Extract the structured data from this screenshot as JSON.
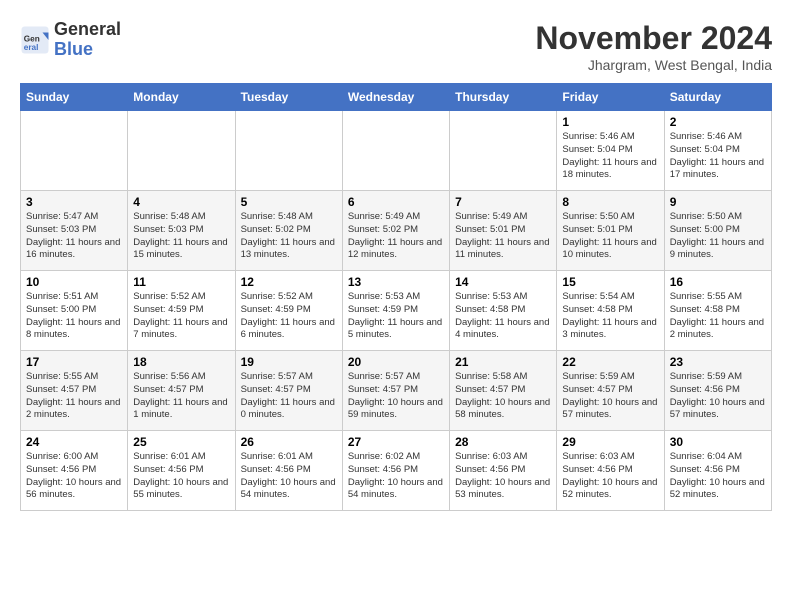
{
  "header": {
    "logo_general": "General",
    "logo_blue": "Blue",
    "month_title": "November 2024",
    "location": "Jhargram, West Bengal, India"
  },
  "days_of_week": [
    "Sunday",
    "Monday",
    "Tuesday",
    "Wednesday",
    "Thursday",
    "Friday",
    "Saturday"
  ],
  "weeks": [
    [
      {
        "day": "",
        "info": ""
      },
      {
        "day": "",
        "info": ""
      },
      {
        "day": "",
        "info": ""
      },
      {
        "day": "",
        "info": ""
      },
      {
        "day": "",
        "info": ""
      },
      {
        "day": "1",
        "info": "Sunrise: 5:46 AM\nSunset: 5:04 PM\nDaylight: 11 hours and 18 minutes."
      },
      {
        "day": "2",
        "info": "Sunrise: 5:46 AM\nSunset: 5:04 PM\nDaylight: 11 hours and 17 minutes."
      }
    ],
    [
      {
        "day": "3",
        "info": "Sunrise: 5:47 AM\nSunset: 5:03 PM\nDaylight: 11 hours and 16 minutes."
      },
      {
        "day": "4",
        "info": "Sunrise: 5:48 AM\nSunset: 5:03 PM\nDaylight: 11 hours and 15 minutes."
      },
      {
        "day": "5",
        "info": "Sunrise: 5:48 AM\nSunset: 5:02 PM\nDaylight: 11 hours and 13 minutes."
      },
      {
        "day": "6",
        "info": "Sunrise: 5:49 AM\nSunset: 5:02 PM\nDaylight: 11 hours and 12 minutes."
      },
      {
        "day": "7",
        "info": "Sunrise: 5:49 AM\nSunset: 5:01 PM\nDaylight: 11 hours and 11 minutes."
      },
      {
        "day": "8",
        "info": "Sunrise: 5:50 AM\nSunset: 5:01 PM\nDaylight: 11 hours and 10 minutes."
      },
      {
        "day": "9",
        "info": "Sunrise: 5:50 AM\nSunset: 5:00 PM\nDaylight: 11 hours and 9 minutes."
      }
    ],
    [
      {
        "day": "10",
        "info": "Sunrise: 5:51 AM\nSunset: 5:00 PM\nDaylight: 11 hours and 8 minutes."
      },
      {
        "day": "11",
        "info": "Sunrise: 5:52 AM\nSunset: 4:59 PM\nDaylight: 11 hours and 7 minutes."
      },
      {
        "day": "12",
        "info": "Sunrise: 5:52 AM\nSunset: 4:59 PM\nDaylight: 11 hours and 6 minutes."
      },
      {
        "day": "13",
        "info": "Sunrise: 5:53 AM\nSunset: 4:59 PM\nDaylight: 11 hours and 5 minutes."
      },
      {
        "day": "14",
        "info": "Sunrise: 5:53 AM\nSunset: 4:58 PM\nDaylight: 11 hours and 4 minutes."
      },
      {
        "day": "15",
        "info": "Sunrise: 5:54 AM\nSunset: 4:58 PM\nDaylight: 11 hours and 3 minutes."
      },
      {
        "day": "16",
        "info": "Sunrise: 5:55 AM\nSunset: 4:58 PM\nDaylight: 11 hours and 2 minutes."
      }
    ],
    [
      {
        "day": "17",
        "info": "Sunrise: 5:55 AM\nSunset: 4:57 PM\nDaylight: 11 hours and 2 minutes."
      },
      {
        "day": "18",
        "info": "Sunrise: 5:56 AM\nSunset: 4:57 PM\nDaylight: 11 hours and 1 minute."
      },
      {
        "day": "19",
        "info": "Sunrise: 5:57 AM\nSunset: 4:57 PM\nDaylight: 11 hours and 0 minutes."
      },
      {
        "day": "20",
        "info": "Sunrise: 5:57 AM\nSunset: 4:57 PM\nDaylight: 10 hours and 59 minutes."
      },
      {
        "day": "21",
        "info": "Sunrise: 5:58 AM\nSunset: 4:57 PM\nDaylight: 10 hours and 58 minutes."
      },
      {
        "day": "22",
        "info": "Sunrise: 5:59 AM\nSunset: 4:57 PM\nDaylight: 10 hours and 57 minutes."
      },
      {
        "day": "23",
        "info": "Sunrise: 5:59 AM\nSunset: 4:56 PM\nDaylight: 10 hours and 57 minutes."
      }
    ],
    [
      {
        "day": "24",
        "info": "Sunrise: 6:00 AM\nSunset: 4:56 PM\nDaylight: 10 hours and 56 minutes."
      },
      {
        "day": "25",
        "info": "Sunrise: 6:01 AM\nSunset: 4:56 PM\nDaylight: 10 hours and 55 minutes."
      },
      {
        "day": "26",
        "info": "Sunrise: 6:01 AM\nSunset: 4:56 PM\nDaylight: 10 hours and 54 minutes."
      },
      {
        "day": "27",
        "info": "Sunrise: 6:02 AM\nSunset: 4:56 PM\nDaylight: 10 hours and 54 minutes."
      },
      {
        "day": "28",
        "info": "Sunrise: 6:03 AM\nSunset: 4:56 PM\nDaylight: 10 hours and 53 minutes."
      },
      {
        "day": "29",
        "info": "Sunrise: 6:03 AM\nSunset: 4:56 PM\nDaylight: 10 hours and 52 minutes."
      },
      {
        "day": "30",
        "info": "Sunrise: 6:04 AM\nSunset: 4:56 PM\nDaylight: 10 hours and 52 minutes."
      }
    ]
  ]
}
